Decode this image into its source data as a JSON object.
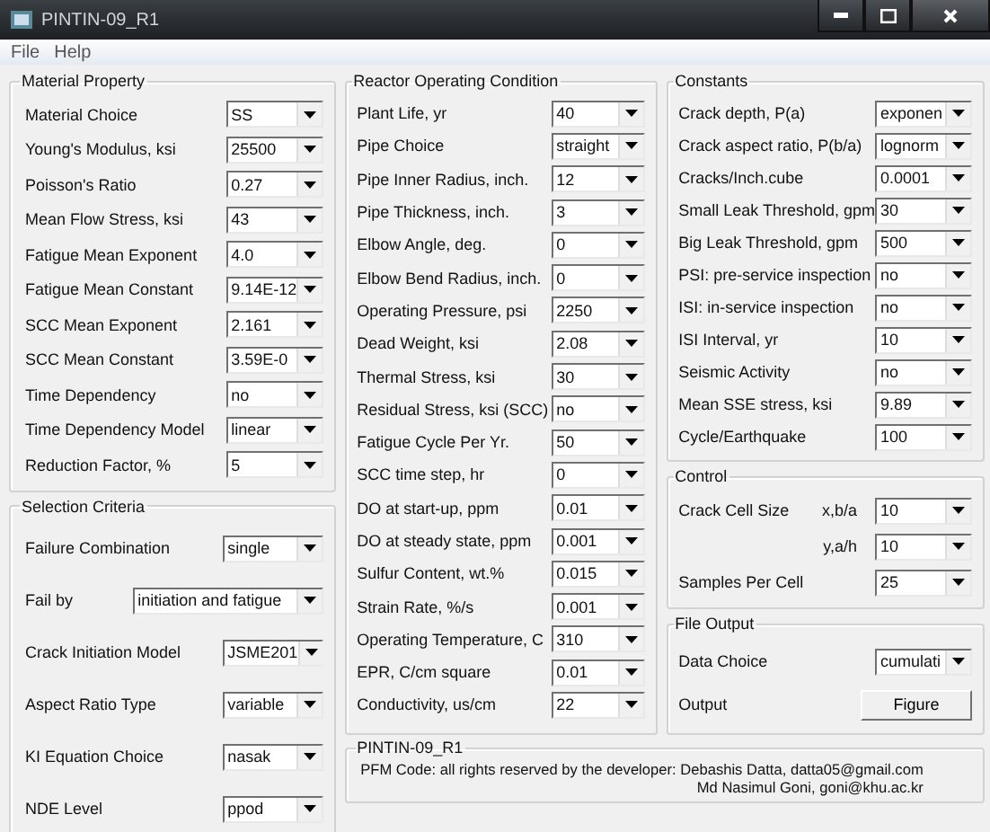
{
  "window": {
    "title": "PINTIN-09_R1"
  },
  "menu": [
    "File",
    "Help"
  ],
  "material_property": {
    "title": "Material Property",
    "rows": [
      {
        "label": "Material Choice",
        "value": "SS"
      },
      {
        "label": "Young's Modulus, ksi",
        "value": "25500"
      },
      {
        "label": "Poisson's Ratio",
        "value": "0.27"
      },
      {
        "label": "Mean Flow Stress, ksi",
        "value": "43"
      },
      {
        "label": "Fatigue Mean Exponent",
        "value": "4.0"
      },
      {
        "label": "Fatigue Mean Constant",
        "value": "9.14E-12"
      },
      {
        "label": "SCC Mean Exponent",
        "value": "2.161"
      },
      {
        "label": "SCC Mean Constant",
        "value": "3.59E-0"
      },
      {
        "label": "Time Dependency",
        "value": "no"
      },
      {
        "label": "Time Dependency Model",
        "value": "linear"
      },
      {
        "label": "Reduction Factor, %",
        "value": "5"
      }
    ]
  },
  "selection_criteria": {
    "title": "Selection Criteria",
    "rows": [
      {
        "kind": "dropdown",
        "label": "Failure Combination",
        "value": "single"
      },
      {
        "kind": "wide",
        "label": "Fail by",
        "value": "initiation and fatigue"
      },
      {
        "kind": "dropdown",
        "label": "Crack Initiation Model",
        "value": "JSME201"
      },
      {
        "kind": "dropdown",
        "label": "Aspect Ratio Type",
        "value": "variable"
      },
      {
        "kind": "dropdown",
        "label": "KI Equation Choice",
        "value": "nasak"
      },
      {
        "kind": "dropdown",
        "label": "NDE Level",
        "value": "ppod"
      }
    ]
  },
  "reactor_operating_condition": {
    "title": "Reactor Operating Condition",
    "rows": [
      {
        "label": "Plant Life, yr",
        "value": "40"
      },
      {
        "label": "Pipe Choice",
        "value": "straight"
      },
      {
        "label": "Pipe Inner Radius, inch.",
        "value": "12"
      },
      {
        "label": "Pipe Thickness, inch.",
        "value": "3"
      },
      {
        "label": "Elbow Angle, deg.",
        "value": "0"
      },
      {
        "label": "Elbow Bend Radius, inch.",
        "value": "0"
      },
      {
        "label": "Operating Pressure, psi",
        "value": "2250"
      },
      {
        "label": "Dead Weight, ksi",
        "value": "2.08"
      },
      {
        "label": "Thermal Stress, ksi",
        "value": "30"
      },
      {
        "label": "Residual Stress, ksi (SCC)",
        "value": "no"
      },
      {
        "label": "Fatigue Cycle Per Yr.",
        "value": "50"
      },
      {
        "label": "SCC time step, hr",
        "value": "0"
      },
      {
        "label": "DO at start-up, ppm",
        "value": "0.01"
      },
      {
        "label": "DO at steady state, ppm",
        "value": "0.001"
      },
      {
        "label": "Sulfur Content, wt.%",
        "value": "0.015"
      },
      {
        "label": "Strain Rate, %/s",
        "value": "0.001"
      },
      {
        "label": "Operating Temperature, C",
        "value": "310"
      },
      {
        "label": "EPR, C/cm square",
        "value": "0.01"
      },
      {
        "label": "Conductivity, us/cm",
        "value": "22"
      }
    ]
  },
  "constants": {
    "title": "Constants",
    "rows": [
      {
        "label": "Crack depth, P(a)",
        "value": "exponen"
      },
      {
        "label": "Crack aspect ratio, P(b/a)",
        "value": "lognorm"
      },
      {
        "label": "Cracks/Inch.cube",
        "value": "0.0001"
      },
      {
        "label": "Small Leak Threshold, gpm",
        "value": "30"
      },
      {
        "label": "Big Leak Threshold, gpm",
        "value": "500"
      },
      {
        "label": "PSI: pre-service inspection",
        "value": "no"
      },
      {
        "label": "ISI: in-service inspection",
        "value": "no"
      },
      {
        "label": "ISI Interval, yr",
        "value": "10"
      },
      {
        "label": "Seismic Activity",
        "value": "no"
      },
      {
        "label": "Mean SSE stress, ksi",
        "value": "9.89"
      },
      {
        "label": "Cycle/Earthquake",
        "value": "100"
      }
    ]
  },
  "control": {
    "title": "Control",
    "rows": [
      {
        "label": "Crack Cell Size",
        "sublabel": "x,b/a",
        "value": "10"
      },
      {
        "sublabel": "y,a/h",
        "value": "10"
      },
      {
        "label": "Samples Per Cell",
        "value": "25"
      }
    ]
  },
  "file_output": {
    "title": "File Output",
    "rows": [
      {
        "kind": "dropdown",
        "label": "Data Choice",
        "value": "cumulati"
      },
      {
        "kind": "button",
        "label": "Output",
        "value": "Figure"
      }
    ]
  },
  "footer": {
    "title": "PINTIN-09_R1",
    "lines": [
      "PFM Code: all rights reserved by the developer: Debashis Datta, datta05@gmail.com",
      "Md Nasimul Goni,  goni@khu.ac.kr"
    ]
  }
}
